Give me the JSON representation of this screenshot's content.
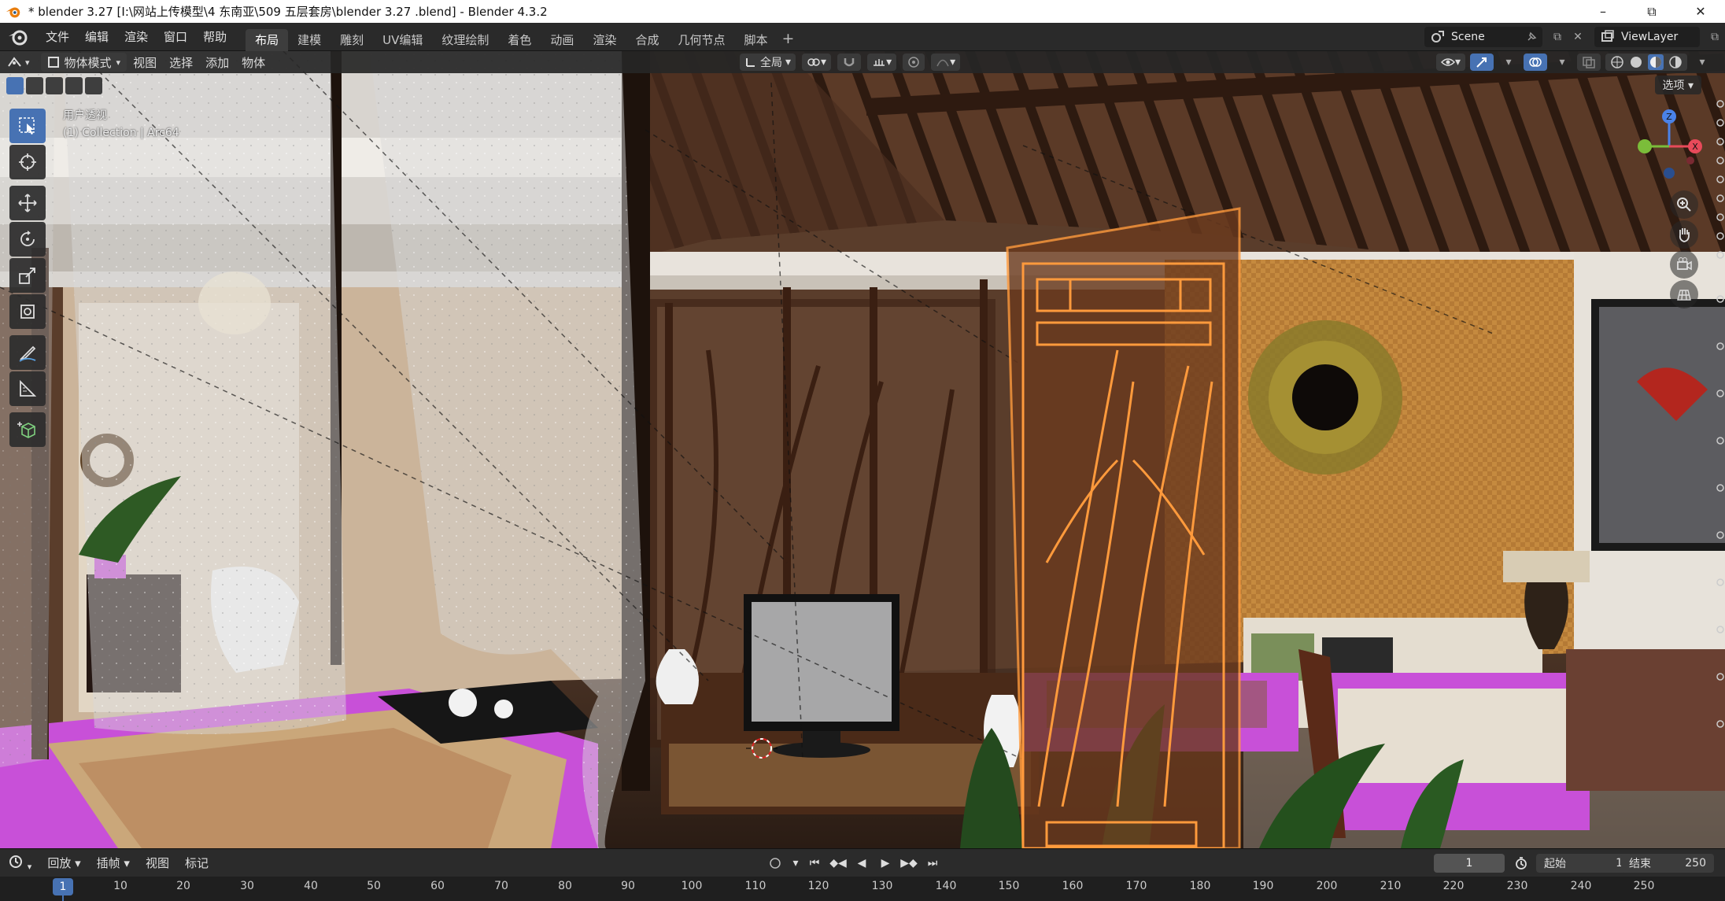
{
  "window": {
    "title": "* blender 3.27  [I:\\网站上传模型\\4 东南亚\\509 五层套房\\blender 3.27 .blend] - Blender 4.3.2",
    "minimize": "–",
    "maximize": "⧉",
    "close": "✕"
  },
  "menubar": {
    "menus": [
      "文件",
      "编辑",
      "渲染",
      "窗口",
      "帮助"
    ],
    "workspaces": [
      "布局",
      "建模",
      "雕刻",
      "UV编辑",
      "纹理绘制",
      "着色",
      "动画",
      "渲染",
      "合成",
      "几何节点",
      "脚本"
    ],
    "active_workspace": "布局",
    "add_tab": "+",
    "scene": "Scene",
    "view_layer": "ViewLayer"
  },
  "viewport_header": {
    "mode": "物体模式",
    "menus": [
      "视图",
      "选择",
      "添加",
      "物体"
    ],
    "transform_orientation": "全局",
    "options": "选项"
  },
  "viewport": {
    "view_name": "用户透视",
    "collection_info": "(1) Collection | Arc64"
  },
  "gizmo": {
    "z": "Z",
    "x": "X"
  },
  "timeline": {
    "menus": [
      "回放",
      "插帧",
      "视图",
      "标记"
    ],
    "current_frame": "1",
    "start_label": "起始",
    "start": "1",
    "end_label": "结束",
    "end": "250",
    "ticks": [
      "10",
      "20",
      "30",
      "40",
      "50",
      "60",
      "70",
      "80",
      "90",
      "100",
      "110",
      "120",
      "130",
      "140",
      "150",
      "160",
      "170",
      "180",
      "190",
      "200",
      "210",
      "220",
      "230",
      "240",
      "250"
    ],
    "ruler_current": "1"
  },
  "colors": {
    "accent": "#4772b3",
    "selection_outline": "#ff9a3c",
    "missing_texture": "#c850d8"
  }
}
